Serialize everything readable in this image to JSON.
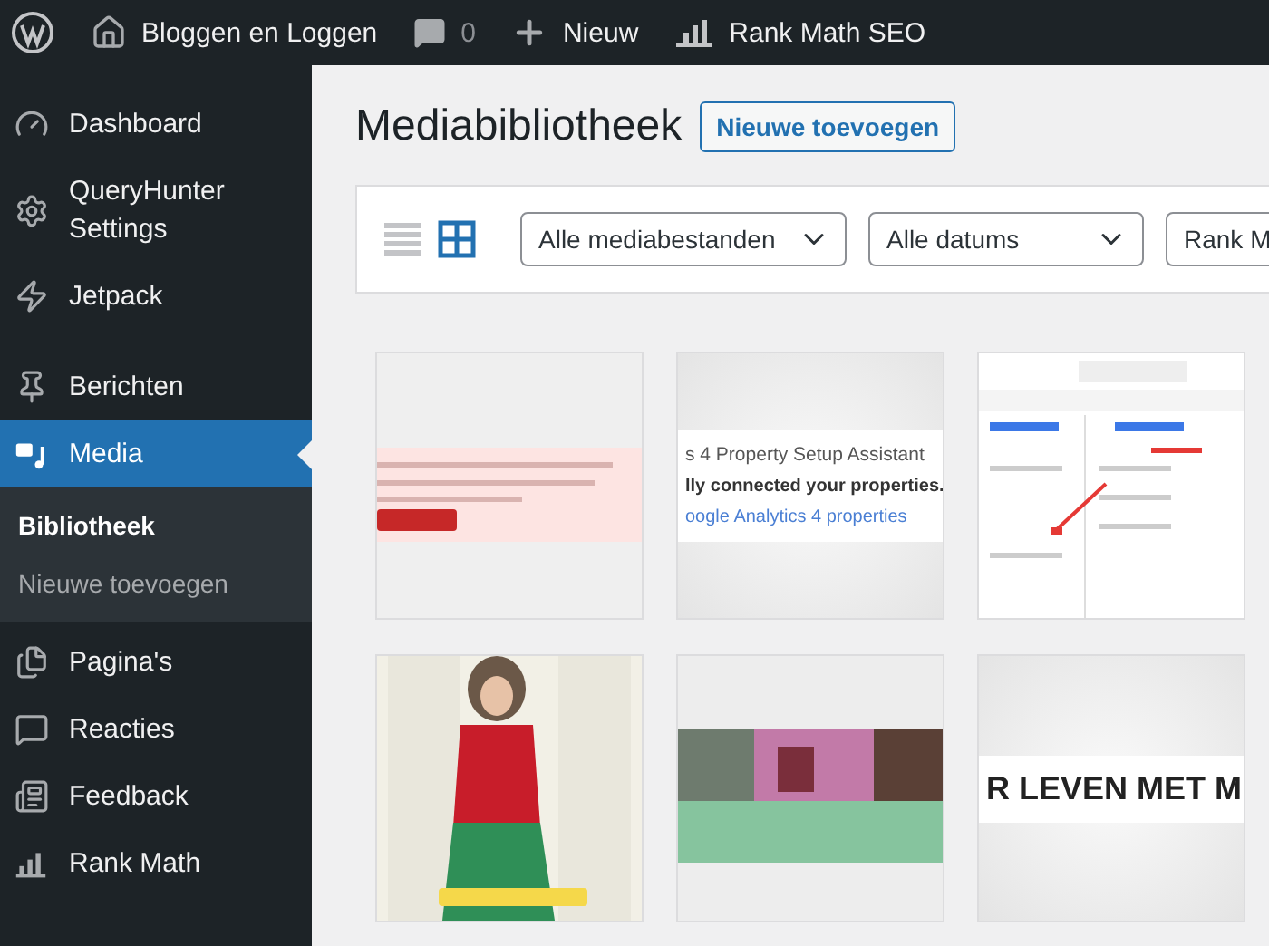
{
  "admin_bar": {
    "items": [
      {
        "kind": "logo"
      },
      {
        "kind": "home",
        "label": "Bloggen en Loggen"
      },
      {
        "kind": "comments",
        "label": "0"
      },
      {
        "kind": "new",
        "label": "Nieuw"
      },
      {
        "kind": "rankmath",
        "label": "Rank Math SEO"
      }
    ]
  },
  "sidebar": {
    "items": [
      {
        "kind": "dashboard",
        "label": "Dashboard",
        "selected": false
      },
      {
        "kind": "settings",
        "label": "QueryHunter Settings",
        "selected": false
      },
      {
        "kind": "jetpack",
        "label": "Jetpack",
        "selected": false
      },
      {
        "kind": "pin",
        "label": "Berichten",
        "selected": false
      },
      {
        "kind": "media",
        "label": "Media",
        "selected": true,
        "children": [
          {
            "label": "Bibliotheek",
            "selected": true
          },
          {
            "label": "Nieuwe toevoegen",
            "selected": false
          }
        ]
      },
      {
        "kind": "pages",
        "label": "Pagina's",
        "selected": false
      },
      {
        "kind": "comments",
        "label": "Reacties",
        "selected": false
      },
      {
        "kind": "feedback",
        "label": "Feedback",
        "selected": false
      },
      {
        "kind": "rankmath",
        "label": "Rank Math",
        "selected": false
      }
    ]
  },
  "page": {
    "title": "Mediabibliotheek",
    "add_button": "Nieuwe toevoegen"
  },
  "toolbar": {
    "view_modes": [
      {
        "kind": "list",
        "selected": false
      },
      {
        "kind": "grid",
        "selected": true
      }
    ],
    "filters": [
      "Alle mediabestanden",
      "Alle datums",
      "Rank M"
    ]
  },
  "thumbnails": [
    {
      "kind": "picture"
    },
    {
      "kind": "text-band",
      "lines": [
        {
          "kind": "heading",
          "text": "s 4 Property Setup Assistant"
        },
        {
          "kind": "bold",
          "text": "lly connected your properties."
        },
        {
          "kind": "link",
          "text": "oogle Analytics 4 properties"
        }
      ]
    },
    {
      "kind": "picture"
    },
    {
      "kind": "picture"
    },
    {
      "kind": "picture"
    },
    {
      "kind": "text-band",
      "lines": [
        {
          "kind": "display",
          "text": "R LEVEN MET M"
        }
      ]
    }
  ]
}
